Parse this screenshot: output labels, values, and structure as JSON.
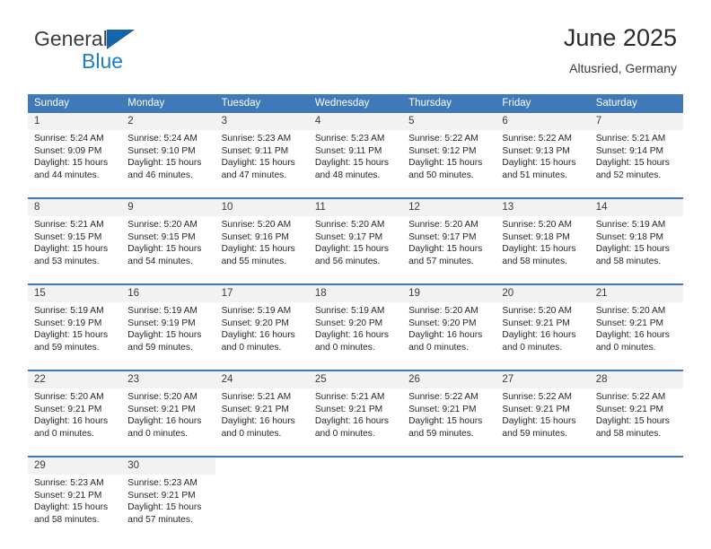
{
  "brand": {
    "name_top": "General",
    "name_bottom": "Blue",
    "flag_icon": "blue-triangle-flag-icon",
    "color_top": "#3b3b3b",
    "color_bottom": "#1d7fc4"
  },
  "header": {
    "title": "June 2025",
    "location": "Altusried, Germany"
  },
  "theme": {
    "header_blue": "#3f79b7",
    "daynum_background": "#f2f2f2",
    "text": "#262626"
  },
  "calendar": {
    "weekday_headers": [
      "Sunday",
      "Monday",
      "Tuesday",
      "Wednesday",
      "Thursday",
      "Friday",
      "Saturday"
    ],
    "weeks": [
      {
        "days": [
          {
            "num": "1",
            "l1": "Sunrise: 5:24 AM",
            "l2": "Sunset: 9:09 PM",
            "l3": "Daylight: 15 hours",
            "l4": "and 44 minutes."
          },
          {
            "num": "2",
            "l1": "Sunrise: 5:24 AM",
            "l2": "Sunset: 9:10 PM",
            "l3": "Daylight: 15 hours",
            "l4": "and 46 minutes."
          },
          {
            "num": "3",
            "l1": "Sunrise: 5:23 AM",
            "l2": "Sunset: 9:11 PM",
            "l3": "Daylight: 15 hours",
            "l4": "and 47 minutes."
          },
          {
            "num": "4",
            "l1": "Sunrise: 5:23 AM",
            "l2": "Sunset: 9:11 PM",
            "l3": "Daylight: 15 hours",
            "l4": "and 48 minutes."
          },
          {
            "num": "5",
            "l1": "Sunrise: 5:22 AM",
            "l2": "Sunset: 9:12 PM",
            "l3": "Daylight: 15 hours",
            "l4": "and 50 minutes."
          },
          {
            "num": "6",
            "l1": "Sunrise: 5:22 AM",
            "l2": "Sunset: 9:13 PM",
            "l3": "Daylight: 15 hours",
            "l4": "and 51 minutes."
          },
          {
            "num": "7",
            "l1": "Sunrise: 5:21 AM",
            "l2": "Sunset: 9:14 PM",
            "l3": "Daylight: 15 hours",
            "l4": "and 52 minutes."
          }
        ]
      },
      {
        "days": [
          {
            "num": "8",
            "l1": "Sunrise: 5:21 AM",
            "l2": "Sunset: 9:15 PM",
            "l3": "Daylight: 15 hours",
            "l4": "and 53 minutes."
          },
          {
            "num": "9",
            "l1": "Sunrise: 5:20 AM",
            "l2": "Sunset: 9:15 PM",
            "l3": "Daylight: 15 hours",
            "l4": "and 54 minutes."
          },
          {
            "num": "10",
            "l1": "Sunrise: 5:20 AM",
            "l2": "Sunset: 9:16 PM",
            "l3": "Daylight: 15 hours",
            "l4": "and 55 minutes."
          },
          {
            "num": "11",
            "l1": "Sunrise: 5:20 AM",
            "l2": "Sunset: 9:17 PM",
            "l3": "Daylight: 15 hours",
            "l4": "and 56 minutes."
          },
          {
            "num": "12",
            "l1": "Sunrise: 5:20 AM",
            "l2": "Sunset: 9:17 PM",
            "l3": "Daylight: 15 hours",
            "l4": "and 57 minutes."
          },
          {
            "num": "13",
            "l1": "Sunrise: 5:20 AM",
            "l2": "Sunset: 9:18 PM",
            "l3": "Daylight: 15 hours",
            "l4": "and 58 minutes."
          },
          {
            "num": "14",
            "l1": "Sunrise: 5:19 AM",
            "l2": "Sunset: 9:18 PM",
            "l3": "Daylight: 15 hours",
            "l4": "and 58 minutes."
          }
        ]
      },
      {
        "days": [
          {
            "num": "15",
            "l1": "Sunrise: 5:19 AM",
            "l2": "Sunset: 9:19 PM",
            "l3": "Daylight: 15 hours",
            "l4": "and 59 minutes."
          },
          {
            "num": "16",
            "l1": "Sunrise: 5:19 AM",
            "l2": "Sunset: 9:19 PM",
            "l3": "Daylight: 15 hours",
            "l4": "and 59 minutes."
          },
          {
            "num": "17",
            "l1": "Sunrise: 5:19 AM",
            "l2": "Sunset: 9:20 PM",
            "l3": "Daylight: 16 hours",
            "l4": "and 0 minutes."
          },
          {
            "num": "18",
            "l1": "Sunrise: 5:19 AM",
            "l2": "Sunset: 9:20 PM",
            "l3": "Daylight: 16 hours",
            "l4": "and 0 minutes."
          },
          {
            "num": "19",
            "l1": "Sunrise: 5:20 AM",
            "l2": "Sunset: 9:20 PM",
            "l3": "Daylight: 16 hours",
            "l4": "and 0 minutes."
          },
          {
            "num": "20",
            "l1": "Sunrise: 5:20 AM",
            "l2": "Sunset: 9:21 PM",
            "l3": "Daylight: 16 hours",
            "l4": "and 0 minutes."
          },
          {
            "num": "21",
            "l1": "Sunrise: 5:20 AM",
            "l2": "Sunset: 9:21 PM",
            "l3": "Daylight: 16 hours",
            "l4": "and 0 minutes."
          }
        ]
      },
      {
        "days": [
          {
            "num": "22",
            "l1": "Sunrise: 5:20 AM",
            "l2": "Sunset: 9:21 PM",
            "l3": "Daylight: 16 hours",
            "l4": "and 0 minutes."
          },
          {
            "num": "23",
            "l1": "Sunrise: 5:20 AM",
            "l2": "Sunset: 9:21 PM",
            "l3": "Daylight: 16 hours",
            "l4": "and 0 minutes."
          },
          {
            "num": "24",
            "l1": "Sunrise: 5:21 AM",
            "l2": "Sunset: 9:21 PM",
            "l3": "Daylight: 16 hours",
            "l4": "and 0 minutes."
          },
          {
            "num": "25",
            "l1": "Sunrise: 5:21 AM",
            "l2": "Sunset: 9:21 PM",
            "l3": "Daylight: 16 hours",
            "l4": "and 0 minutes."
          },
          {
            "num": "26",
            "l1": "Sunrise: 5:22 AM",
            "l2": "Sunset: 9:21 PM",
            "l3": "Daylight: 15 hours",
            "l4": "and 59 minutes."
          },
          {
            "num": "27",
            "l1": "Sunrise: 5:22 AM",
            "l2": "Sunset: 9:21 PM",
            "l3": "Daylight: 15 hours",
            "l4": "and 59 minutes."
          },
          {
            "num": "28",
            "l1": "Sunrise: 5:22 AM",
            "l2": "Sunset: 9:21 PM",
            "l3": "Daylight: 15 hours",
            "l4": "and 58 minutes."
          }
        ]
      },
      {
        "days": [
          {
            "num": "29",
            "l1": "Sunrise: 5:23 AM",
            "l2": "Sunset: 9:21 PM",
            "l3": "Daylight: 15 hours",
            "l4": "and 58 minutes."
          },
          {
            "num": "30",
            "l1": "Sunrise: 5:23 AM",
            "l2": "Sunset: 9:21 PM",
            "l3": "Daylight: 15 hours",
            "l4": "and 57 minutes."
          },
          {
            "num": "",
            "l1": "",
            "l2": "",
            "l3": "",
            "l4": ""
          },
          {
            "num": "",
            "l1": "",
            "l2": "",
            "l3": "",
            "l4": ""
          },
          {
            "num": "",
            "l1": "",
            "l2": "",
            "l3": "",
            "l4": ""
          },
          {
            "num": "",
            "l1": "",
            "l2": "",
            "l3": "",
            "l4": ""
          },
          {
            "num": "",
            "l1": "",
            "l2": "",
            "l3": "",
            "l4": ""
          }
        ]
      }
    ]
  }
}
